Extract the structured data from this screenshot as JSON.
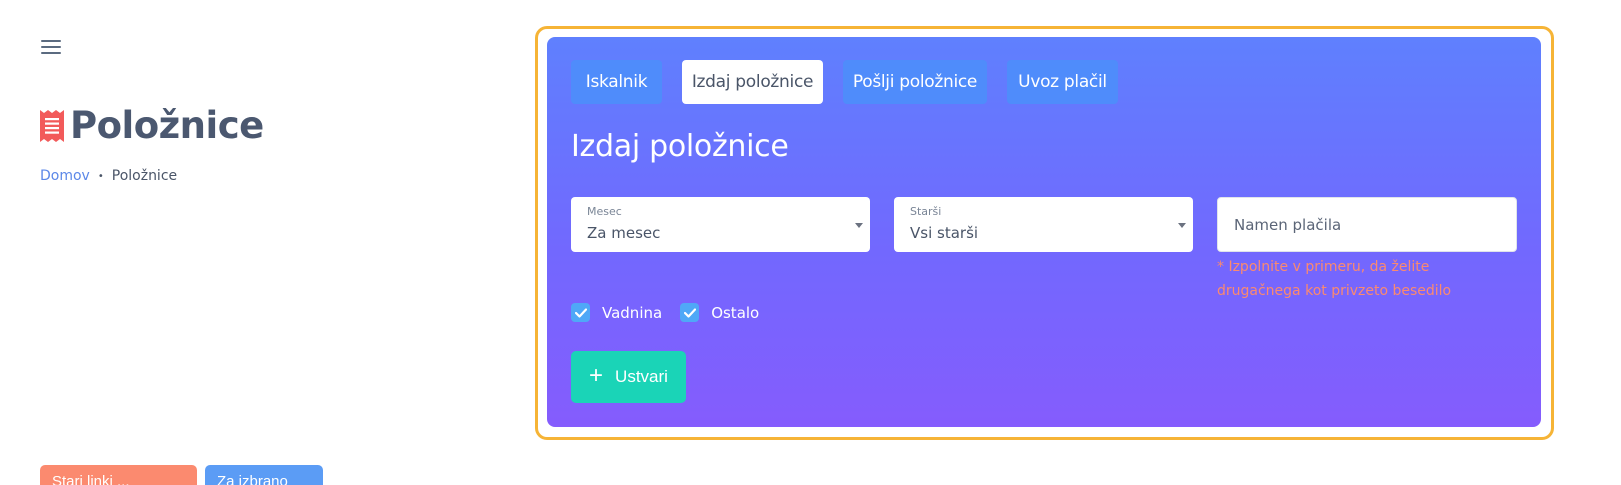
{
  "header": {
    "title": "Položnice"
  },
  "breadcrumb": {
    "home": "Domov",
    "separator": "•",
    "current": "Položnice"
  },
  "bottom_buttons": {
    "old_links": "Stari linki ...",
    "select": "Za izbrano"
  },
  "tabs": [
    {
      "label": "Iskalnik",
      "active": false
    },
    {
      "label": "Izdaj položnice",
      "active": true
    },
    {
      "label": "Pošlji položnice",
      "active": false
    },
    {
      "label": "Uvoz plačil",
      "active": false
    }
  ],
  "card": {
    "title": "Izdaj položnice"
  },
  "form": {
    "month": {
      "label": "Mesec",
      "value": "Za mesec"
    },
    "parents": {
      "label": "Starši",
      "value": "Vsi starši"
    },
    "purpose": {
      "placeholder": "Namen plačila",
      "value": ""
    },
    "hint": "* Izpolnite v primeru, da želite drugačnega kot privzeto besedilo"
  },
  "checkboxes": [
    {
      "label": "Vadnina",
      "checked": true
    },
    {
      "label": "Ostalo",
      "checked": true
    }
  ],
  "actions": {
    "create_icon": "+",
    "create_label": "Ustvari"
  },
  "colors": {
    "accent_outline": "#f6b436",
    "card_gradient_top": "#5f80fe",
    "card_gradient_bottom": "#855cfd",
    "tab_bg": "#4f8cfb",
    "create_button": "#1ad4b7",
    "hint": "#fb8a6f",
    "page_title_icon": "#f25a5a"
  },
  "icons": {
    "menu": "hamburger-menu-icon",
    "title": "receipt-icon",
    "checkbox": "check-icon",
    "create": "plus-icon",
    "select_caret": "chevron-down-icon"
  }
}
